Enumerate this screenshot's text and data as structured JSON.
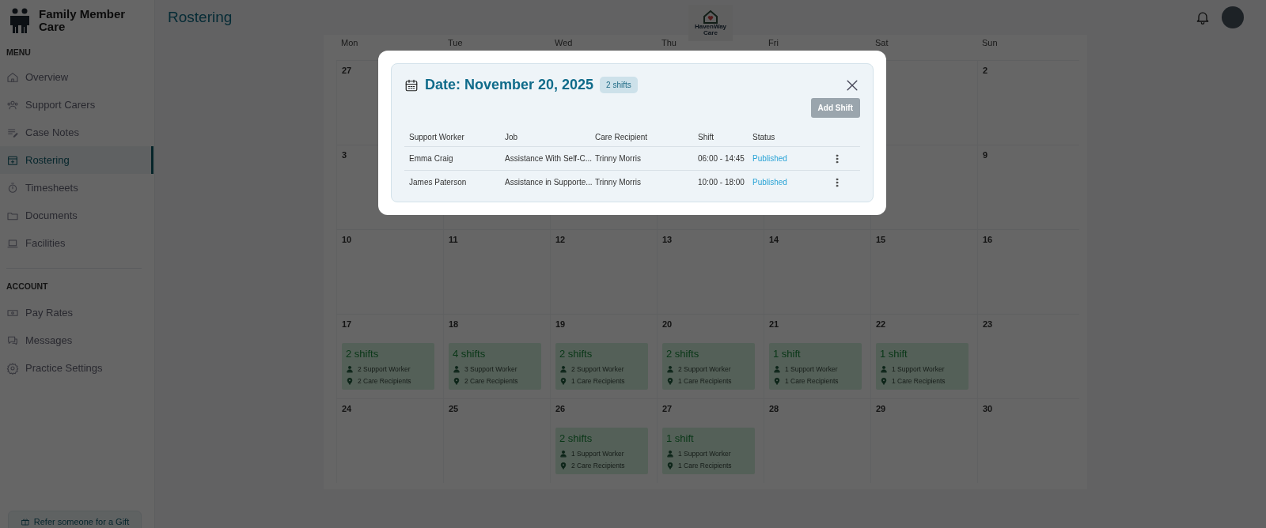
{
  "sidebar": {
    "brand": "Family Member Care",
    "sections": [
      {
        "heading": "MENU",
        "items": [
          {
            "label": "Overview",
            "selected": false
          },
          {
            "label": "Support Carers",
            "selected": false
          },
          {
            "label": "Case Notes",
            "selected": false
          },
          {
            "label": "Rostering",
            "selected": true
          },
          {
            "label": "Timesheets",
            "selected": false
          },
          {
            "label": "Documents",
            "selected": false
          },
          {
            "label": "Facilities",
            "selected": false
          }
        ]
      },
      {
        "heading": "ACCOUNT",
        "items": [
          {
            "label": "Pay Rates",
            "selected": false
          },
          {
            "label": "Messages",
            "selected": false
          },
          {
            "label": "Practice Settings",
            "selected": false
          }
        ]
      }
    ],
    "refer_button": "Refer someone for a Gift"
  },
  "header": {
    "title": "Rostering",
    "logo_text": [
      "HavenWay",
      "Care"
    ]
  },
  "calendar": {
    "weekdays": [
      "Mon",
      "Tue",
      "Wed",
      "Thu",
      "Fri",
      "Sat",
      "Sun"
    ],
    "weeks": [
      {
        "first": {
          "day": "27"
        },
        "last": {
          "day": "2"
        }
      },
      {
        "first": {
          "day": "3"
        },
        "last": {
          "day": "9"
        }
      },
      {
        "cells": [
          {
            "day": "10"
          },
          {
            "day": "11"
          },
          {
            "day": "12"
          },
          {
            "day": "13"
          },
          {
            "day": "14"
          },
          {
            "day": "15"
          },
          {
            "day": "16"
          }
        ]
      },
      {
        "cells": [
          {
            "day": "17",
            "summary": {
              "shifts": "2 shifts",
              "workers": "2 Support Worker",
              "recipients": "2 Care Recipients"
            }
          },
          {
            "day": "18",
            "summary": {
              "shifts": "4 shifts",
              "workers": "3 Support Worker",
              "recipients": "2 Care Recipients"
            }
          },
          {
            "day": "19",
            "summary": {
              "shifts": "2 shifts",
              "workers": "2 Support Worker",
              "recipients": "1 Care Recipients"
            }
          },
          {
            "day": "20",
            "summary": {
              "shifts": "2 shifts",
              "workers": "2 Support Worker",
              "recipients": "1 Care Recipients"
            }
          },
          {
            "day": "21",
            "summary": {
              "shifts": "1 shift",
              "workers": "1 Support Worker",
              "recipients": "1 Care Recipients"
            }
          },
          {
            "day": "22",
            "summary": {
              "shifts": "1 shift",
              "workers": "1 Support Worker",
              "recipients": "1 Care Recipients"
            }
          },
          {
            "day": "23"
          }
        ]
      },
      {
        "cells": [
          {
            "day": "24"
          },
          {
            "day": "25"
          },
          {
            "day": "26",
            "summary": {
              "shifts": "2 shifts",
              "workers": "1 Support Worker",
              "recipients": "2 Care Recipients"
            }
          },
          {
            "day": "27",
            "summary": {
              "shifts": "1 shift",
              "workers": "1 Support Worker",
              "recipients": "1 Care Recipients"
            }
          },
          {
            "day": "28"
          },
          {
            "day": "29"
          },
          {
            "day": "30"
          }
        ]
      }
    ]
  },
  "modal": {
    "title": "Date: November 20, 2025",
    "badge": "2 shifts",
    "add_button": {
      "label": "Add Shift",
      "disabled": true
    },
    "columns": [
      "Support Worker",
      "Job",
      "Care Recipient",
      "Shift",
      "Status"
    ],
    "rows": [
      {
        "worker": "Emma Craig",
        "job": "Assistance With Self-C...",
        "recipient": "Trinny Morris",
        "shift": "06:00 - 14:45",
        "status": "Published"
      },
      {
        "worker": "James Paterson",
        "job": "Assistance in Supporte...",
        "recipient": "Trinny Morris",
        "shift": "10:00 - 18:00",
        "status": "Published"
      }
    ]
  }
}
